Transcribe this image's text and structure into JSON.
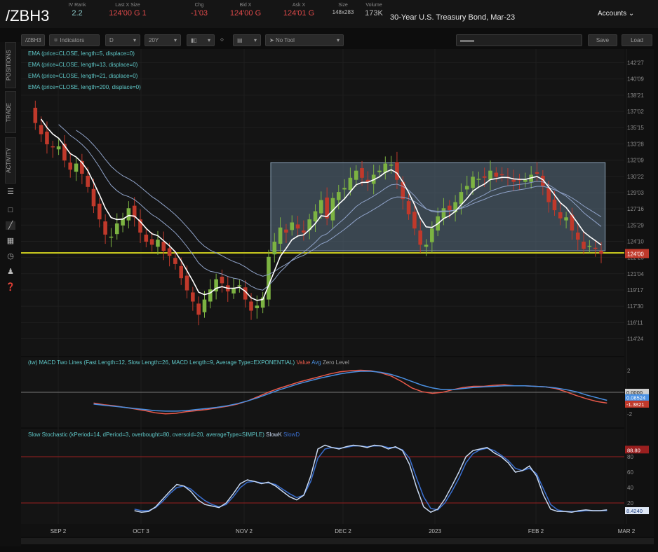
{
  "header": {
    "symbol": "/ZBH3",
    "quotes": [
      {
        "label": "IV Rank",
        "value": "2.2",
        "color": "#8fd0d0"
      },
      {
        "label": "Last X Size",
        "value": "124'00 G 1",
        "color": "#e04a4a"
      },
      {
        "label": "Chg",
        "value": "-1'03",
        "color": "#e04a4a"
      },
      {
        "label": "Bid X",
        "value": "124'00 G",
        "color": "#e04a4a"
      },
      {
        "label": "Ask X",
        "value": "124'01 G",
        "color": "#e04a4a"
      },
      {
        "label": "Size",
        "value": "148x283",
        "color": "#bdbdbd"
      },
      {
        "label": "Volume",
        "value": "173K",
        "color": "#bdbdbd"
      }
    ],
    "description": "30-Year U.S. Treasury Bond, Mar-23",
    "accounts": "Accounts"
  },
  "toolbar": {
    "symbol": "/ZBH3",
    "indicators": "Indicators",
    "aggregation": "D",
    "timeframe": "20Y",
    "tool": "No Tool",
    "save": "Save",
    "load": "Load"
  },
  "side_tabs": [
    "POSITIONS",
    "TRADE",
    "ACTIVITY"
  ],
  "studies": {
    "price": [
      "EMA (price=CLOSE, length=5, displace=0)",
      "EMA (price=CLOSE, length=13, displace=0)",
      "EMA (price=CLOSE, length=21, displace=0)",
      "EMA (price=CLOSE, length=200, displace=0)"
    ],
    "macd": "(tw) MACD Two Lines (Fast Length=12, Slow Length=26, MACD Length=9, Average Type=EXPONENTIAL)",
    "macd_legend": [
      "Value",
      "Avg",
      "Zero Level"
    ],
    "stoch": "Slow Stochastic (kPeriod=14, dPeriod=3, overbought=80, oversold=20, averageType=SIMPLE)",
    "stoch_legend": [
      "SlowK",
      "SlowD"
    ]
  },
  "colors": {
    "up": "#7cb342",
    "down": "#c0392b",
    "ema5": "#ffffff",
    "ema_long": "#8fa2c8",
    "support": "#c8c81e",
    "macd_value": "#e8594a",
    "macd_avg": "#4a90e2",
    "stoch_k": "#c8d8f0",
    "stoch_d": "#3a6fd0",
    "range_box": "#5a6f82"
  },
  "chart_data": [
    {
      "type": "candlestick",
      "title": "/ZBH3 Daily",
      "x_labels": [
        "SEP 2",
        "OCT 3",
        "NOV 2",
        "DEC 2",
        "2023",
        "FEB 2",
        "MAR 2"
      ],
      "y_ticks": [
        "142'27",
        "140'09",
        "138'21",
        "137'02",
        "135'15",
        "133'28",
        "132'09",
        "130'22",
        "129'03",
        "127'16",
        "125'29",
        "124'10",
        "122'23",
        "121'04",
        "119'17",
        "117'30",
        "116'11",
        "114'24"
      ],
      "ylim": [
        114.5,
        143.5
      ],
      "price_label": "124'00",
      "support_level": 124.1,
      "range_box": {
        "from": "NOV 7",
        "to": "FEB 22",
        "low": 124.3,
        "high": 133.0
      },
      "close": [
        138.6,
        136.9,
        135.8,
        134.8,
        134.5,
        134.6,
        133.2,
        132.3,
        132.9,
        131.9,
        130.6,
        128.7,
        127.4,
        125.9,
        125.7,
        127.0,
        127.5,
        128.5,
        127.6,
        126.1,
        125.2,
        124.9,
        125.4,
        124.3,
        123.8,
        123.0,
        121.6,
        120.4,
        119.3,
        118.0,
        119.5,
        120.5,
        121.5,
        121.1,
        120.3,
        120.6,
        120.9,
        119.5,
        118.4,
        118.9,
        119.7,
        123.7,
        125.2,
        126.6,
        126.1,
        127.1,
        126.5,
        126.1,
        127.4,
        128.2,
        129.3,
        127.5,
        129.5,
        130.1,
        130.5,
        131.5,
        132.2,
        131.5,
        131.1,
        131.8,
        132.2,
        132.9,
        132.8,
        131.3,
        129.4,
        127.9,
        126.5,
        124.9,
        124.9,
        126.5,
        127.7,
        128.5,
        128.3,
        129.1,
        130.1,
        130.7,
        131.6,
        131.4,
        131.5,
        132.2,
        131.6,
        131.8,
        131.5,
        131.1,
        131.3,
        131.3,
        131.8,
        131.9,
        130.7,
        129.1,
        128.3,
        127.5,
        127.6,
        126.3,
        125.4,
        124.5,
        124.8,
        124.5,
        124.0
      ],
      "ema5_label": "EMA 5",
      "ema13_label": "EMA 13",
      "ema21_label": "EMA 21"
    },
    {
      "type": "line",
      "title": "(tw) MACD Two Lines",
      "y_ticks": [
        "2",
        "-2"
      ],
      "ylim": [
        -2.6,
        2.6
      ],
      "value_labels": [
        "0.0000",
        "0.08524",
        "-1.3821"
      ],
      "series": [
        {
          "name": "Value",
          "x_range": [
            11,
            99
          ],
          "values": [
            -1.0,
            -1.15,
            -1.25,
            -1.4,
            -1.55,
            -1.7,
            -1.9,
            -2.0,
            -1.95,
            -1.8,
            -1.7,
            -1.6,
            -1.45,
            -1.3,
            -1.1,
            -0.8,
            -0.4,
            0.0,
            0.35,
            0.65,
            0.95,
            1.2,
            1.45,
            1.7,
            1.9,
            2.0,
            2.05,
            2.0,
            1.8,
            1.5,
            1.0,
            0.4,
            0.05,
            -0.1,
            0.0,
            0.25,
            0.45,
            0.55,
            0.55,
            0.65,
            0.7,
            0.6,
            0.6,
            0.55,
            0.5,
            0.35,
            0.05,
            -0.3,
            -0.6,
            -0.85,
            -1.0
          ]
        },
        {
          "name": "Avg",
          "x_range": [
            11,
            99
          ],
          "values": [
            -1.1,
            -1.2,
            -1.3,
            -1.4,
            -1.5,
            -1.6,
            -1.7,
            -1.75,
            -1.75,
            -1.7,
            -1.6,
            -1.5,
            -1.4,
            -1.25,
            -1.05,
            -0.8,
            -0.5,
            -0.15,
            0.2,
            0.5,
            0.8,
            1.05,
            1.3,
            1.5,
            1.7,
            1.85,
            1.95,
            1.95,
            1.85,
            1.65,
            1.35,
            1.0,
            0.65,
            0.4,
            0.25,
            0.25,
            0.35,
            0.45,
            0.5,
            0.55,
            0.6,
            0.6,
            0.6,
            0.55,
            0.5,
            0.4,
            0.25,
            0.05,
            -0.25,
            -0.5,
            -0.75
          ]
        }
      ]
    },
    {
      "type": "line",
      "title": "Slow Stochastic",
      "y_ticks": [
        "80",
        "60",
        "40",
        "20"
      ],
      "ylim": [
        0,
        100
      ],
      "overbought": 80,
      "oversold": 20,
      "value_labels": [
        "88.80",
        "8.4240"
      ],
      "series": [
        {
          "name": "SlowK",
          "x_range": [
            18,
            99
          ],
          "values": [
            10,
            8,
            9,
            15,
            25,
            35,
            44,
            42,
            35,
            24,
            18,
            16,
            14,
            20,
            32,
            45,
            50,
            48,
            45,
            47,
            42,
            35,
            28,
            24,
            30,
            55,
            90,
            95,
            92,
            90,
            93,
            95,
            94,
            92,
            95,
            94,
            90,
            93,
            88,
            70,
            40,
            15,
            8,
            12,
            25,
            42,
            60,
            80,
            88,
            90,
            92,
            85,
            80,
            72,
            60,
            62,
            68,
            55,
            30,
            12,
            9,
            9,
            8,
            10,
            11,
            10,
            10,
            11
          ]
        },
        {
          "name": "SlowD",
          "x_range": [
            18,
            99
          ],
          "values": [
            12,
            10,
            10,
            14,
            22,
            32,
            40,
            42,
            38,
            30,
            23,
            18,
            15,
            18,
            28,
            40,
            47,
            48,
            46,
            46,
            44,
            38,
            32,
            27,
            30,
            48,
            78,
            90,
            92,
            91,
            92,
            94,
            94,
            93,
            94,
            94,
            92,
            92,
            89,
            78,
            52,
            28,
            13,
            11,
            20,
            35,
            52,
            72,
            84,
            89,
            91,
            88,
            82,
            75,
            65,
            62,
            65,
            58,
            38,
            18,
            11,
            9,
            9,
            9,
            10,
            10,
            10,
            10
          ]
        }
      ]
    }
  ]
}
